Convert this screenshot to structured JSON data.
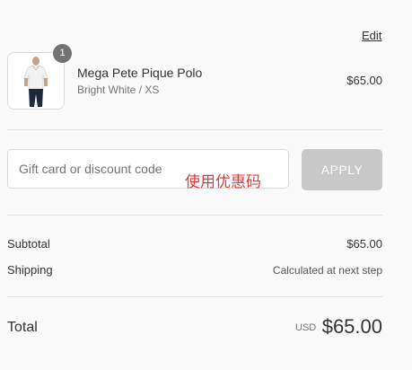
{
  "header": {
    "edit_label": "Edit"
  },
  "product": {
    "quantity": "1",
    "name": "Mega Pete Pique Polo",
    "variant": "Bright White / XS",
    "price": "$65.00",
    "image_icon": "polo-shirt-photo"
  },
  "discount": {
    "placeholder": "Gift card or discount code",
    "annotation": "使用优惠码",
    "apply_label": "APPLY"
  },
  "summary": {
    "subtotal_label": "Subtotal",
    "subtotal_value": "$65.00",
    "shipping_label": "Shipping",
    "shipping_value": "Calculated at next step",
    "total_label": "Total",
    "total_currency": "USD",
    "total_value": "$65.00"
  },
  "colors": {
    "annotation": "#e03b3b",
    "apply_disabled": "#c8c8c8",
    "badge": "#737373"
  }
}
